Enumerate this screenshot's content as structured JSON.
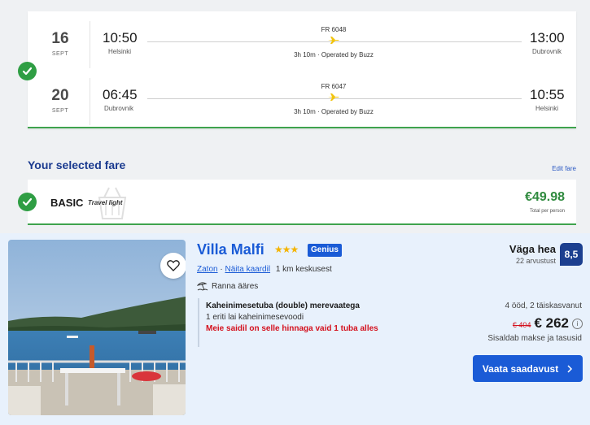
{
  "flights": [
    {
      "day": "16",
      "month": "SEPT",
      "depart_time": "10:50",
      "depart_city": "Helsinki",
      "flight_no": "FR 6048",
      "duration": "3h 10m · Operated by Buzz",
      "arrive_time": "13:00",
      "arrive_city": "Dubrovnik"
    },
    {
      "day": "20",
      "month": "SEPT",
      "depart_time": "06:45",
      "depart_city": "Dubrovnik",
      "flight_no": "FR 6047",
      "duration": "3h 10m · Operated by Buzz",
      "arrive_time": "10:55",
      "arrive_city": "Helsinki"
    }
  ],
  "fare": {
    "heading": "Your selected fare",
    "edit_label": "Edit fare",
    "name": "BASIC",
    "subtitle": "Travel light",
    "price": "€49.98",
    "price_note": "Total per person"
  },
  "hotel": {
    "name": "Villa Malfi",
    "stars": "★★★",
    "genius_label": "Genius",
    "location_link": "Zaton",
    "map_link": "Näita kaardil",
    "distance": "1 km keskusest",
    "beach": "Ranna ääres",
    "room_type": "Kaheinimesetuba (double) merevaatega",
    "bed": "1 eriti lai kaheinimesevoodi",
    "warning": "Meie saidil on selle hinnaga vaid 1 tuba alles",
    "review_word": "Väga hea",
    "review_count": "22 arvustust",
    "score": "8,5",
    "stay_info": "4 ööd, 2 täiskasvanut",
    "old_price": "€ 404",
    "new_price": "€ 262",
    "tax_note": "Sisaldab makse ja tasusid",
    "cta_label": "Vaata saadavust"
  },
  "colors": {
    "accent_blue": "#1a5bd6",
    "success_green": "#2f9e44",
    "warning_red": "#d4111e",
    "score_navy": "#1c3f8f"
  }
}
